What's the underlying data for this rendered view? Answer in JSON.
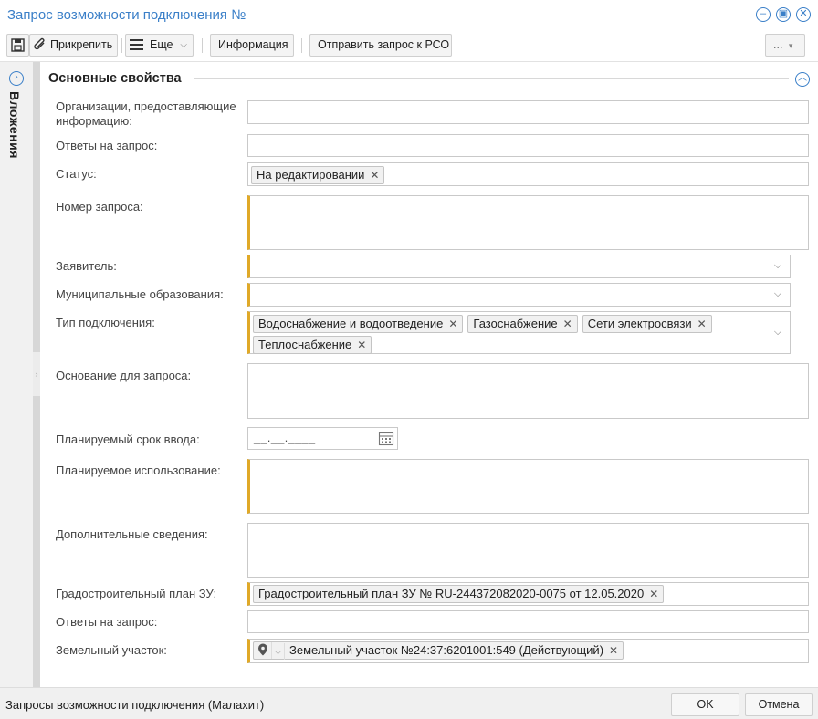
{
  "window": {
    "title": "Запрос возможности подключения №"
  },
  "toolbar": {
    "attach_label": "Прикрепить",
    "more_label": "Еще",
    "info_label": "Информация",
    "send_label": "Отправить запрос к РСО",
    "ellipsis_label": "..."
  },
  "sidebar": {
    "attachments_label": "Вложения"
  },
  "section": {
    "title": "Основные свойства"
  },
  "fields": {
    "org_label": "Организации, предоставляющие информацию:",
    "answers1_label": "Ответы на запрос:",
    "status_label": "Статус:",
    "status_value": "На редактировании",
    "request_number_label": "Номер запроса:",
    "applicant_label": "Заявитель:",
    "municipal_label": "Муниципальные образования:",
    "connection_type_label": "Тип подключения:",
    "connection_types": [
      "Водоснабжение и водоотведение",
      "Газоснабжение",
      "Сети электросвязи",
      "Теплоснабжение"
    ],
    "basis_label": "Основание для запроса:",
    "planned_date_label": "Планируемый срок ввода:",
    "planned_date_placeholder": "__.__.____",
    "planned_use_label": "Планируемое использование:",
    "additional_label": "Дополнительные сведения:",
    "gradplan_label": "Градостроительный план ЗУ:",
    "gradplan_value": "Градостроительный план ЗУ № RU-244372082020-0075 от 12.05.2020",
    "answers2_label": "Ответы на запрос:",
    "land_label": "Земельный участок:",
    "land_value": "Земельный участок №24:37:6201001:549 (Действующий)"
  },
  "statusbar": {
    "text": "Запросы возможности подключения (Малахит)",
    "ok_label": "OK",
    "cancel_label": "Отмена"
  },
  "colors": {
    "accent": "#3a7fc8",
    "required": "#e0a928"
  }
}
